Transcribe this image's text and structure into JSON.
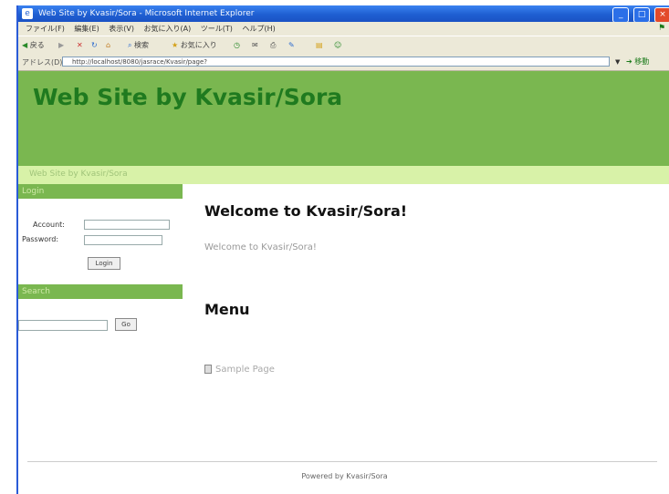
{
  "browser": {
    "title": "Web Site by Kvasir/Sora - Microsoft Internet Explorer",
    "menus": [
      "ファイル(F)",
      "編集(E)",
      "表示(V)",
      "お気に入り(A)",
      "ツール(T)",
      "ヘルプ(H)"
    ],
    "toolbar": {
      "back": "戻る",
      "search": "検索",
      "favorites": "お気に入り"
    },
    "address_label": "アドレス(D)",
    "address_url": "http://localhost/8080/jasrace/Kvasir/page?",
    "go_label": "移動"
  },
  "site": {
    "header_title": "Web Site by Kvasir/Sora",
    "subheader": "Web Site by Kvasir/Sora"
  },
  "login": {
    "heading": "Login",
    "account_label": "Account:",
    "account_value": "",
    "password_label": "Password:",
    "password_value": "",
    "button": "Login"
  },
  "search": {
    "heading": "Search",
    "value": "",
    "button": "Go"
  },
  "main": {
    "welcome_heading": "Welcome to Kvasir/Sora!",
    "welcome_text": "Welcome to Kvasir/Sora!",
    "menu_heading": "Menu",
    "menu_items": [
      {
        "label": "Sample Page"
      }
    ]
  },
  "footer": {
    "text": "Powered by Kvasir/Sora"
  }
}
